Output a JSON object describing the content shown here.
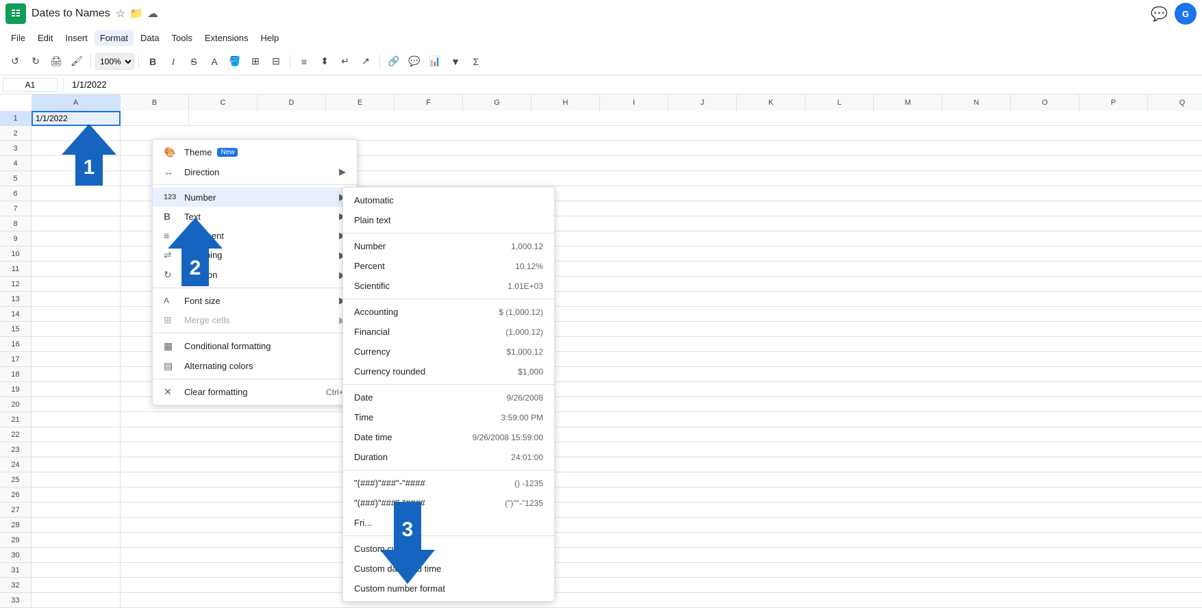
{
  "app": {
    "title": "Dates to Names",
    "logo_letter": "S"
  },
  "menu_bar": {
    "items": [
      "File",
      "Edit",
      "Insert",
      "Format",
      "Data",
      "Tools",
      "Extensions",
      "Help"
    ]
  },
  "toolbar": {
    "undo_label": "↺",
    "redo_label": "↻",
    "print_label": "🖨",
    "paint_label": "🖌"
  },
  "formula_bar": {
    "cell_ref": "A1",
    "value": "1/1/2022"
  },
  "columns": [
    "A",
    "B",
    "C",
    "D",
    "E",
    "F",
    "G",
    "H",
    "I",
    "J",
    "K",
    "L",
    "M",
    "N",
    "O",
    "P",
    "Q"
  ],
  "rows": [
    1,
    2,
    3,
    4,
    5,
    6,
    7,
    8,
    9,
    10,
    11,
    12,
    13,
    14,
    15,
    16,
    17,
    18,
    19,
    20,
    21,
    22,
    23,
    24,
    25,
    26,
    27,
    28,
    29,
    30,
    31,
    32,
    33
  ],
  "cell_a1_value": "1/1/2022",
  "format_menu": {
    "items": [
      {
        "id": "theme",
        "icon": "🎨",
        "label": "Theme",
        "badge": "New",
        "has_arrow": false
      },
      {
        "id": "direction",
        "icon": "↔",
        "label": "Direction",
        "has_arrow": true
      },
      {
        "id": "number",
        "icon": "123",
        "label": "Number",
        "highlighted": true,
        "has_arrow": true
      },
      {
        "id": "text",
        "icon": "B",
        "label": "Text",
        "has_arrow": true
      },
      {
        "id": "alignment",
        "icon": "≡",
        "label": "Alignment",
        "has_arrow": true
      },
      {
        "id": "wrapping",
        "icon": "⇌",
        "label": "Wrapping",
        "has_arrow": true
      },
      {
        "id": "rotation",
        "icon": "↻",
        "label": "Rotation",
        "has_arrow": true
      },
      {
        "id": "font-size",
        "icon": "A",
        "label": "Font size",
        "has_arrow": true
      },
      {
        "id": "merge-cells",
        "icon": "⊞",
        "label": "Merge cells",
        "has_arrow": true,
        "disabled": true
      },
      {
        "id": "conditional",
        "icon": "▦",
        "label": "Conditional formatting",
        "has_arrow": false
      },
      {
        "id": "alternating",
        "icon": "▤",
        "label": "Alternating colors",
        "has_arrow": false
      },
      {
        "id": "clear",
        "icon": "✕",
        "label": "Clear formatting",
        "shortcut": "Ctrl+\\",
        "has_arrow": false
      }
    ]
  },
  "number_submenu": {
    "items": [
      {
        "id": "automatic",
        "label": "Automatic",
        "value": ""
      },
      {
        "id": "plain-text",
        "label": "Plain text",
        "value": ""
      },
      {
        "id": "number",
        "label": "Number",
        "value": "1,000.12"
      },
      {
        "id": "percent",
        "label": "Percent",
        "value": "10.12%"
      },
      {
        "id": "scientific",
        "label": "Scientific",
        "value": "1.01E+03"
      },
      {
        "id": "accounting",
        "label": "Accounting",
        "value": "$ (1,000.12)"
      },
      {
        "id": "financial",
        "label": "Financial",
        "value": "(1,000.12)"
      },
      {
        "id": "currency",
        "label": "Currency",
        "value": "$1,000.12"
      },
      {
        "id": "currency-rounded",
        "label": "Currency rounded",
        "value": "$1,000"
      },
      {
        "id": "date",
        "label": "Date",
        "value": "9/26/2008"
      },
      {
        "id": "time",
        "label": "Time",
        "value": "3:59:00 PM"
      },
      {
        "id": "date-time",
        "label": "Date time",
        "value": "9/26/2008 15:59:00"
      },
      {
        "id": "duration",
        "label": "Duration",
        "value": "24:01:00"
      },
      {
        "id": "format1",
        "label": "\"(###)\"###\"-\"####",
        "value": "() -1235"
      },
      {
        "id": "format2",
        "label": "\"(###)\"###\"-\"####",
        "value": "(\")\"\"-\"1235"
      },
      {
        "id": "friday",
        "label": "Fri...",
        "value": ""
      },
      {
        "id": "custom-currency",
        "label": "Custom currency",
        "value": ""
      },
      {
        "id": "custom-date-time",
        "label": "Custom date and time",
        "value": ""
      },
      {
        "id": "custom-number",
        "label": "Custom number format",
        "value": ""
      }
    ]
  },
  "annotations": [
    {
      "id": "1",
      "type": "up",
      "number": "1"
    },
    {
      "id": "2",
      "type": "up",
      "number": "2"
    },
    {
      "id": "3",
      "type": "down",
      "number": "3"
    }
  ]
}
